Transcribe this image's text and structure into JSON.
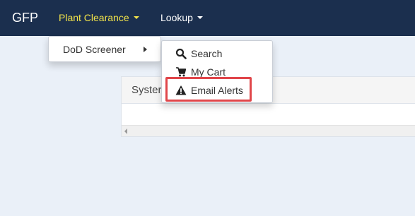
{
  "navbar": {
    "brand": "GFP",
    "items": [
      {
        "label": "Plant Clearance",
        "icon": "caret-down-icon",
        "active": true
      },
      {
        "label": "Lookup",
        "icon": "caret-down-icon"
      }
    ]
  },
  "panel": {
    "heading": "Syster"
  },
  "menu": {
    "item": {
      "label": "DoD Screener",
      "icon": "caret-right-icon"
    }
  },
  "submenu": {
    "items": [
      {
        "label": "Search",
        "icon": "search-icon"
      },
      {
        "label": "My Cart",
        "icon": "cart-icon"
      },
      {
        "label": "Email Alerts",
        "icon": "warning-icon",
        "highlighted": true
      }
    ]
  },
  "colors": {
    "navbar_bg": "#1b2f4e",
    "active_nav": "#f2e34a",
    "page_bg": "#eaf0f8",
    "highlight": "#e0464a"
  }
}
